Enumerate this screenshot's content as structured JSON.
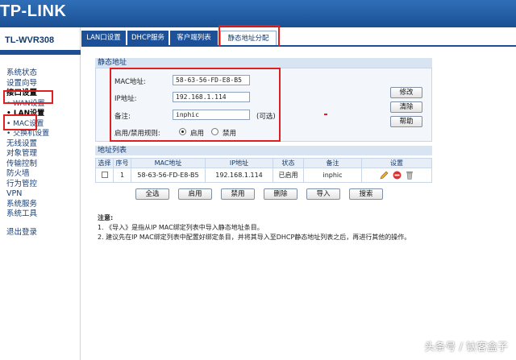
{
  "header": {
    "logo": "TP-LINK",
    "model": "TL-WVR308"
  },
  "nav": {
    "items": [
      {
        "label": "系统状态",
        "bold": false
      },
      {
        "label": "设置向导",
        "bold": false
      },
      {
        "label": "接口设置",
        "bold": true
      },
      {
        "label": "• WAN设置",
        "bold": false,
        "sub": true
      },
      {
        "label": "• LAN设置",
        "bold": false,
        "sub": true
      },
      {
        "label": "• MAC设置",
        "bold": false,
        "sub": true
      },
      {
        "label": "• 交换机设置",
        "bold": false,
        "sub": true
      },
      {
        "label": "无线设置",
        "bold": false
      },
      {
        "label": "对象管理",
        "bold": false
      },
      {
        "label": "传输控制",
        "bold": false
      },
      {
        "label": "防火墙",
        "bold": false
      },
      {
        "label": "行为管控",
        "bold": false
      },
      {
        "label": "VPN",
        "bold": false
      },
      {
        "label": "系统服务",
        "bold": false
      },
      {
        "label": "系统工具",
        "bold": false
      }
    ],
    "logout": "退出登录"
  },
  "tabs": [
    {
      "label": "LAN口设置",
      "active": false
    },
    {
      "label": "DHCP服务",
      "active": false
    },
    {
      "label": "客户端列表",
      "active": false
    },
    {
      "label": "静态地址分配",
      "active": true
    }
  ],
  "static": {
    "title": "静态地址",
    "mac_label": "MAC地址:",
    "mac_value": "58-63-56-FD-E8-B5",
    "ip_label": "IP地址:",
    "ip_value": "192.168.1.114",
    "note_label": "备注:",
    "note_value": "inphic",
    "note_hint": "(可选)",
    "enable_label": "启用/禁用规则:",
    "enable_on": "启用",
    "enable_off": "禁用",
    "btn_modify": "修改",
    "btn_clear": "清除",
    "btn_help": "帮助"
  },
  "list": {
    "title": "地址列表",
    "columns": [
      "选择",
      "序号",
      "MAC地址",
      "IP地址",
      "状态",
      "备注",
      "设置"
    ],
    "rows": [
      {
        "index": "1",
        "mac": "58-63-56-FD-E8-B5",
        "ip": "192.168.1.114",
        "status": "已启用",
        "note": "inphic"
      }
    ],
    "actions": [
      "全选",
      "启用",
      "禁用",
      "删除",
      "导入",
      "搜索"
    ]
  },
  "notes": {
    "title": "注意:",
    "lines": [
      "1. 《导入》是指从IP MAC绑定列表中导入静态地址条目。",
      "2. 建议先在IP MAC绑定列表中配置好绑定条目，并将其导入至DHCP静态地址列表之后，再进行其他的操作。"
    ]
  },
  "watermark": "头条号 / 钛客盒子"
}
